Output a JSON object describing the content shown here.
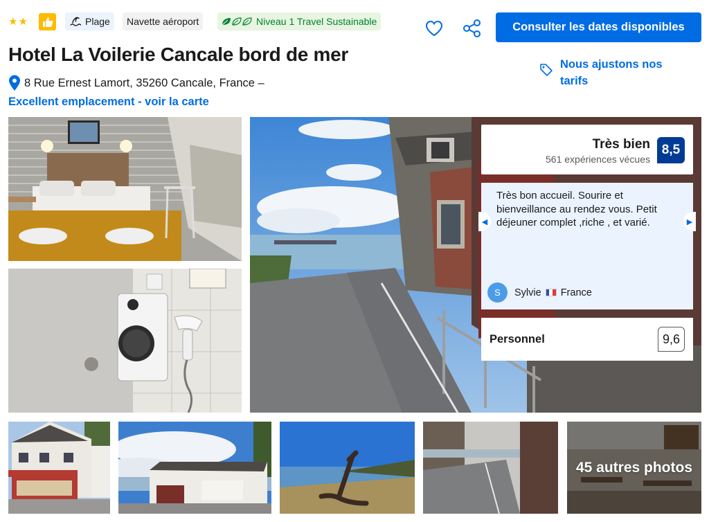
{
  "header": {
    "star_count": 2,
    "chips": {
      "beach": "Plage",
      "shuttle": "Navette aéroport",
      "sustainable": "Niveau 1 Travel Sustainable"
    },
    "cta_label": "Consulter les dates disponibles",
    "icons": [
      "star-icon",
      "thumbs-up-icon",
      "beach-icon",
      "leaf-icon",
      "heart-icon",
      "share-icon",
      "location-pin-icon",
      "price-tag-icon"
    ]
  },
  "hotel": {
    "name": "Hotel La Voilerie Cancale bord de mer",
    "address": "8 Rue Ernest Lamort, 35260 Cancale, France –",
    "map_link": "Excellent emplacement - voir la carte",
    "price_note": "Nous ajustons nos tarifs"
  },
  "review": {
    "label": "Très bien",
    "count": "561 expériences vécues",
    "score": "8,5",
    "quote": "Très bon accueil. Sourire et bienveillance au rendez vous. Petit déjeuner complet ,riche , et varié.",
    "reviewer_initial": "S",
    "reviewer_name": "Sylvie",
    "reviewer_country": "France",
    "category_label": "Personnel",
    "category_score": "9,6"
  },
  "gallery": {
    "more_photos_label": "45 autres photos"
  },
  "colors": {
    "brand_blue": "#006ce4",
    "dark_blue": "#003b95",
    "star_yellow": "#febb02",
    "sustainable_green": "#008234"
  }
}
